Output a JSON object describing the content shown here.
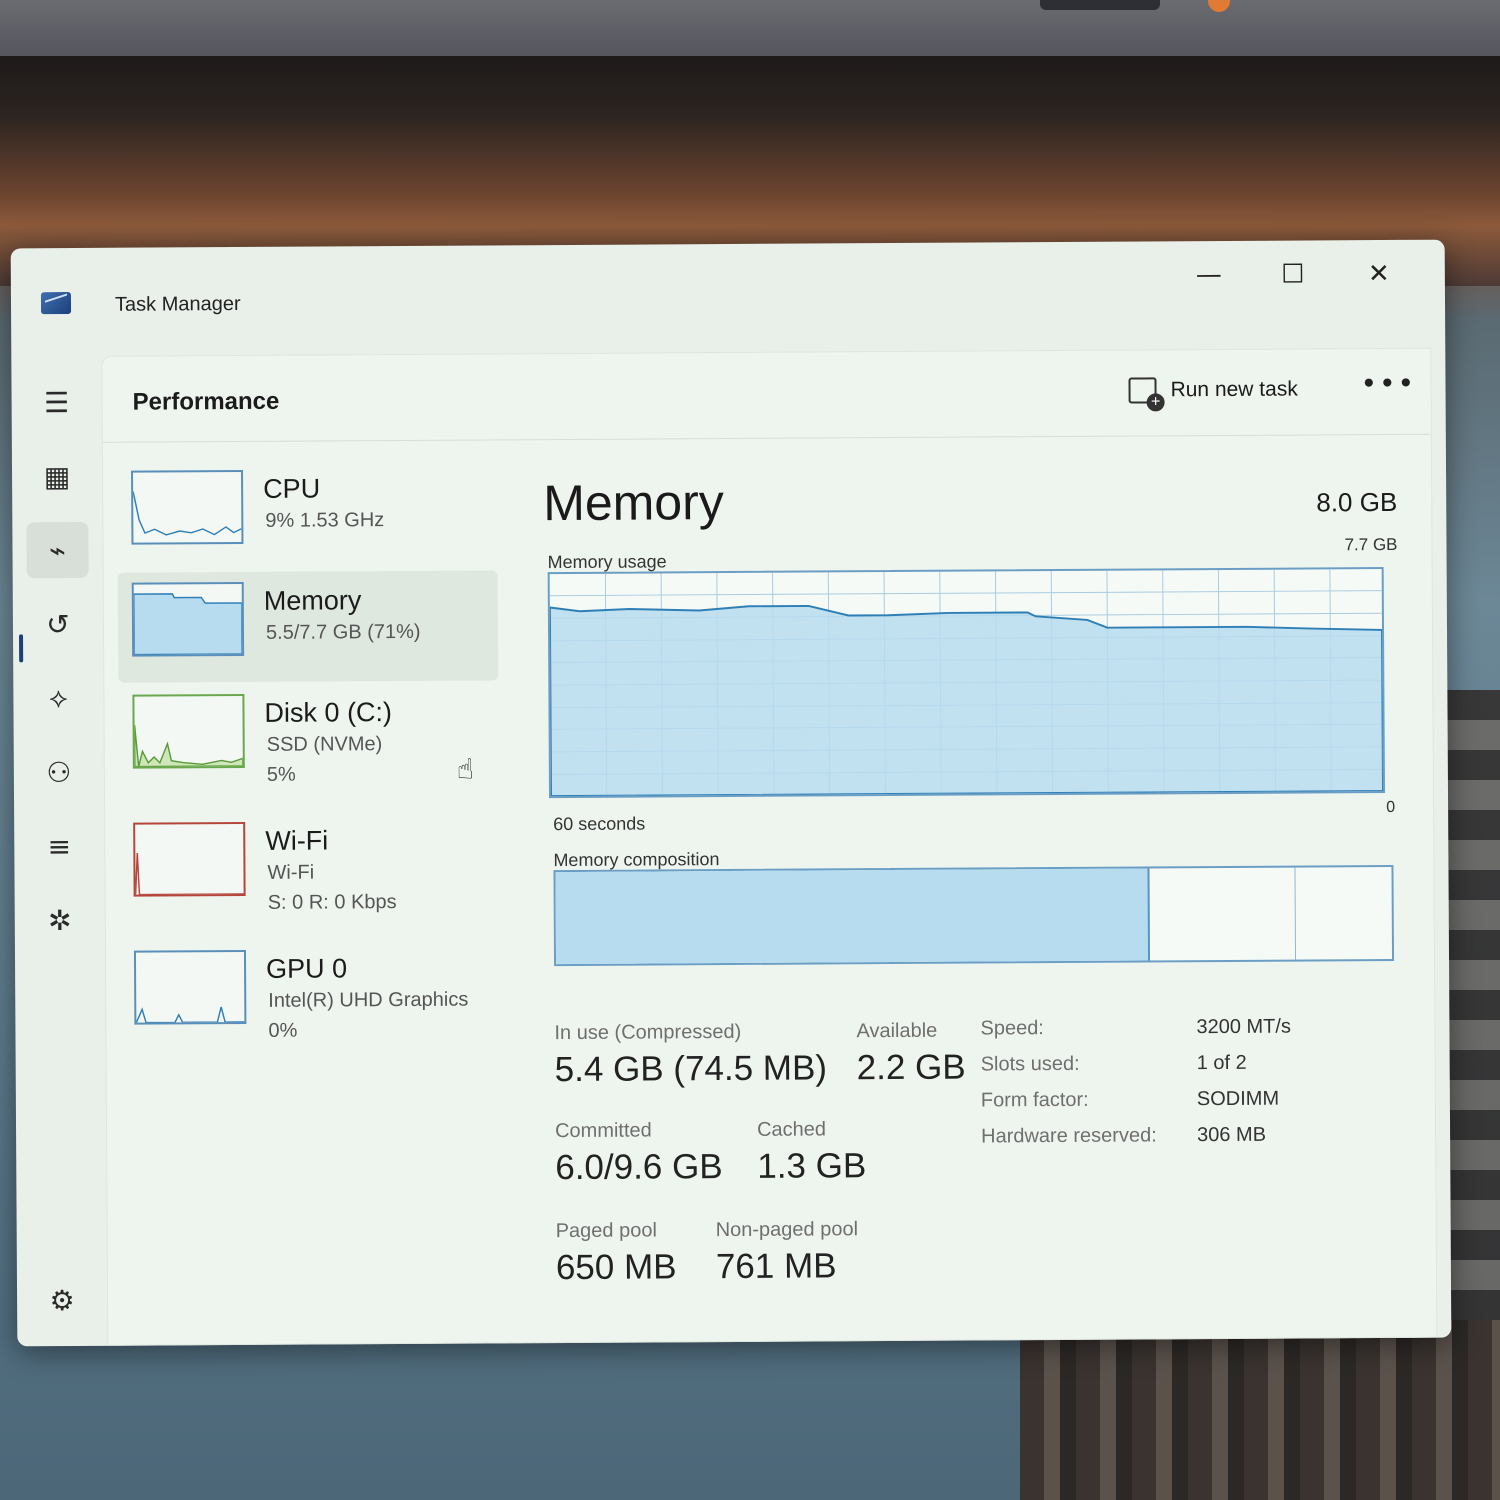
{
  "window": {
    "title": "Task Manager",
    "controls": {
      "minimize": "—",
      "maximize": "☐",
      "close": "✕"
    }
  },
  "header": {
    "page_title": "Performance",
    "run_new_task": "Run new task",
    "more": "•••"
  },
  "nav": {
    "items": [
      {
        "icon": "hamburger-icon",
        "glyph": "☰"
      },
      {
        "icon": "processes-icon",
        "glyph": "▦"
      },
      {
        "icon": "performance-icon",
        "glyph": "⌁",
        "active": true
      },
      {
        "icon": "app-history-icon",
        "glyph": "↺"
      },
      {
        "icon": "startup-apps-icon",
        "glyph": "⟡"
      },
      {
        "icon": "users-icon",
        "glyph": "⚇"
      },
      {
        "icon": "details-icon",
        "glyph": "≡"
      },
      {
        "icon": "services-icon",
        "glyph": "✲"
      }
    ],
    "settings_glyph": "⚙"
  },
  "devices": [
    {
      "name": "CPU",
      "sub1": "9%  1.53 GHz",
      "sub2": "",
      "color": "#2f7fb7"
    },
    {
      "name": "Memory",
      "sub1": "5.5/7.7 GB (71%)",
      "sub2": "",
      "color": "#2f7fb7",
      "selected": true
    },
    {
      "name": "Disk 0 (C:)",
      "sub1": "SSD (NVMe)",
      "sub2": "5%",
      "color": "#5a9a3a"
    },
    {
      "name": "Wi-Fi",
      "sub1": "Wi-Fi",
      "sub2": "S: 0 R: 0 Kbps",
      "color": "#b5463c"
    },
    {
      "name": "GPU 0",
      "sub1": "Intel(R) UHD Graphics",
      "sub2": "0%",
      "color": "#2f7fb7"
    }
  ],
  "detail": {
    "title": "Memory",
    "total": "8.0 GB",
    "usage_label": "Memory usage",
    "usage_max": "7.7 GB",
    "axis_left": "60 seconds",
    "axis_right": "0",
    "composition_label": "Memory composition",
    "composition": {
      "in_use_fraction": 0.71,
      "modified_fraction": 0.175
    },
    "stats": {
      "in_use_label": "In use (Compressed)",
      "in_use_value": "5.4 GB (74.5 MB)",
      "available_label": "Available",
      "available_value": "2.2 GB",
      "committed_label": "Committed",
      "committed_value": "6.0/9.6 GB",
      "cached_label": "Cached",
      "cached_value": "1.3 GB",
      "paged_label": "Paged pool",
      "paged_value": "650 MB",
      "nonpaged_label": "Non-paged pool",
      "nonpaged_value": "761 MB"
    },
    "specs": [
      {
        "key": "Speed:",
        "value": "3200 MT/s"
      },
      {
        "key": "Slots used:",
        "value": "1 of 2"
      },
      {
        "key": "Form factor:",
        "value": "SODIMM"
      },
      {
        "key": "Hardware reserved:",
        "value": "306 MB"
      }
    ]
  }
}
